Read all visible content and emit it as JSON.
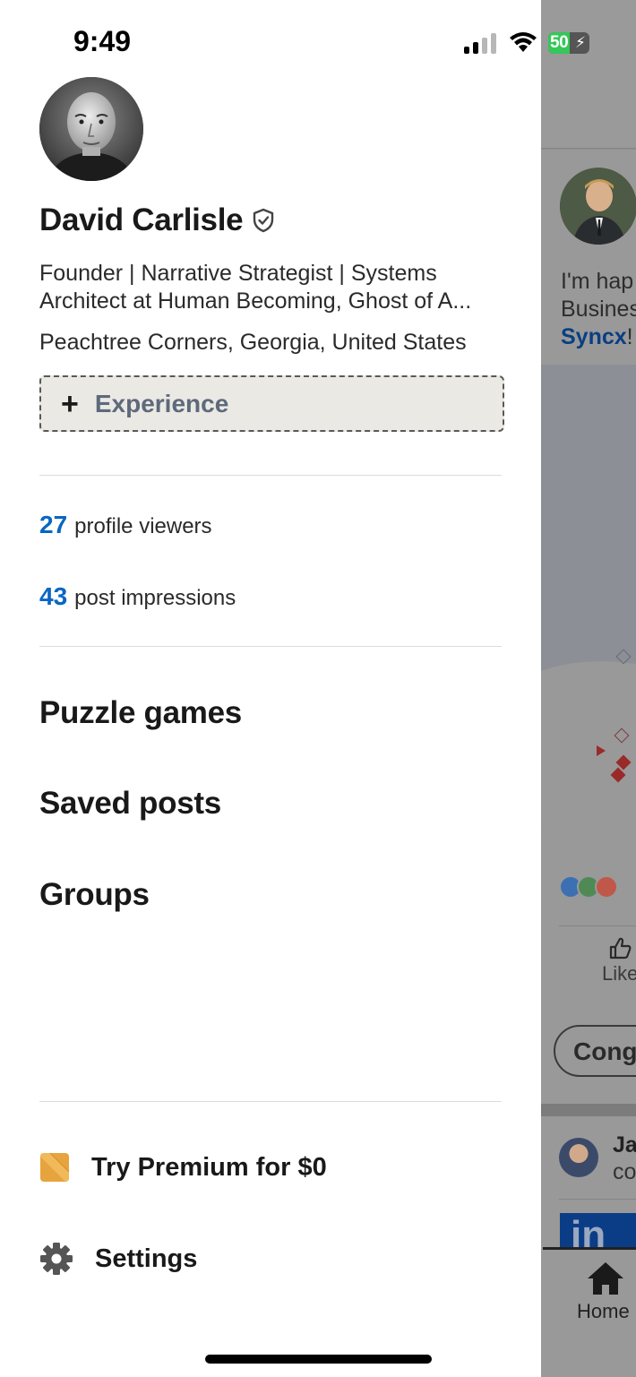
{
  "status_bar": {
    "time": "9:49",
    "battery": "50"
  },
  "profile": {
    "name": "David Carlisle",
    "headline": "Founder | Narrative Strategist | Systems Architect at Human Becoming, Ghost of A...",
    "location": "Peachtree Corners, Georgia, United States",
    "experience_button": "Experience"
  },
  "stats": [
    {
      "value": "27",
      "label": "profile viewers"
    },
    {
      "value": "43",
      "label": "post impressions"
    }
  ],
  "menu": [
    {
      "label": "Puzzle games"
    },
    {
      "label": "Saved posts"
    },
    {
      "label": "Groups"
    }
  ],
  "bottom": {
    "premium_label": "Try Premium for $0",
    "settings_label": "Settings"
  },
  "background_feed": {
    "post_line1": "I'm hap",
    "post_line2": "Busines",
    "post_link": "Syncx",
    "post_link_suffix": "!",
    "like_label": "Like",
    "congrats_label": "Cong",
    "next_post_name": "Ja",
    "next_post_line": "co",
    "banner_text": "in",
    "home_label": "Home"
  },
  "colors": {
    "accent_blue": "#0a66c2",
    "premium_gold": "#e7a33e",
    "experience_bg": "#ebe9e4",
    "overlay_gray": "#8e8e8e"
  }
}
